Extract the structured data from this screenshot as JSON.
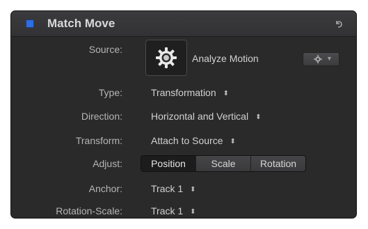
{
  "header": {
    "title": "Match Move",
    "checkbox_color": "#2f6ee0"
  },
  "source": {
    "label": "Source:",
    "button_label": "Analyze Motion",
    "icon": "gear-icon"
  },
  "type": {
    "label": "Type:",
    "value": "Transformation"
  },
  "direction": {
    "label": "Direction:",
    "value": "Horizontal and Vertical"
  },
  "transform": {
    "label": "Transform:",
    "value": "Attach to Source"
  },
  "adjust": {
    "label": "Adjust:",
    "options": [
      "Position",
      "Scale",
      "Rotation"
    ],
    "selected": "Position"
  },
  "anchor": {
    "label": "Anchor:",
    "value": "Track 1"
  },
  "rotation_scale": {
    "label": "Rotation-Scale:",
    "value": "Track 1"
  }
}
